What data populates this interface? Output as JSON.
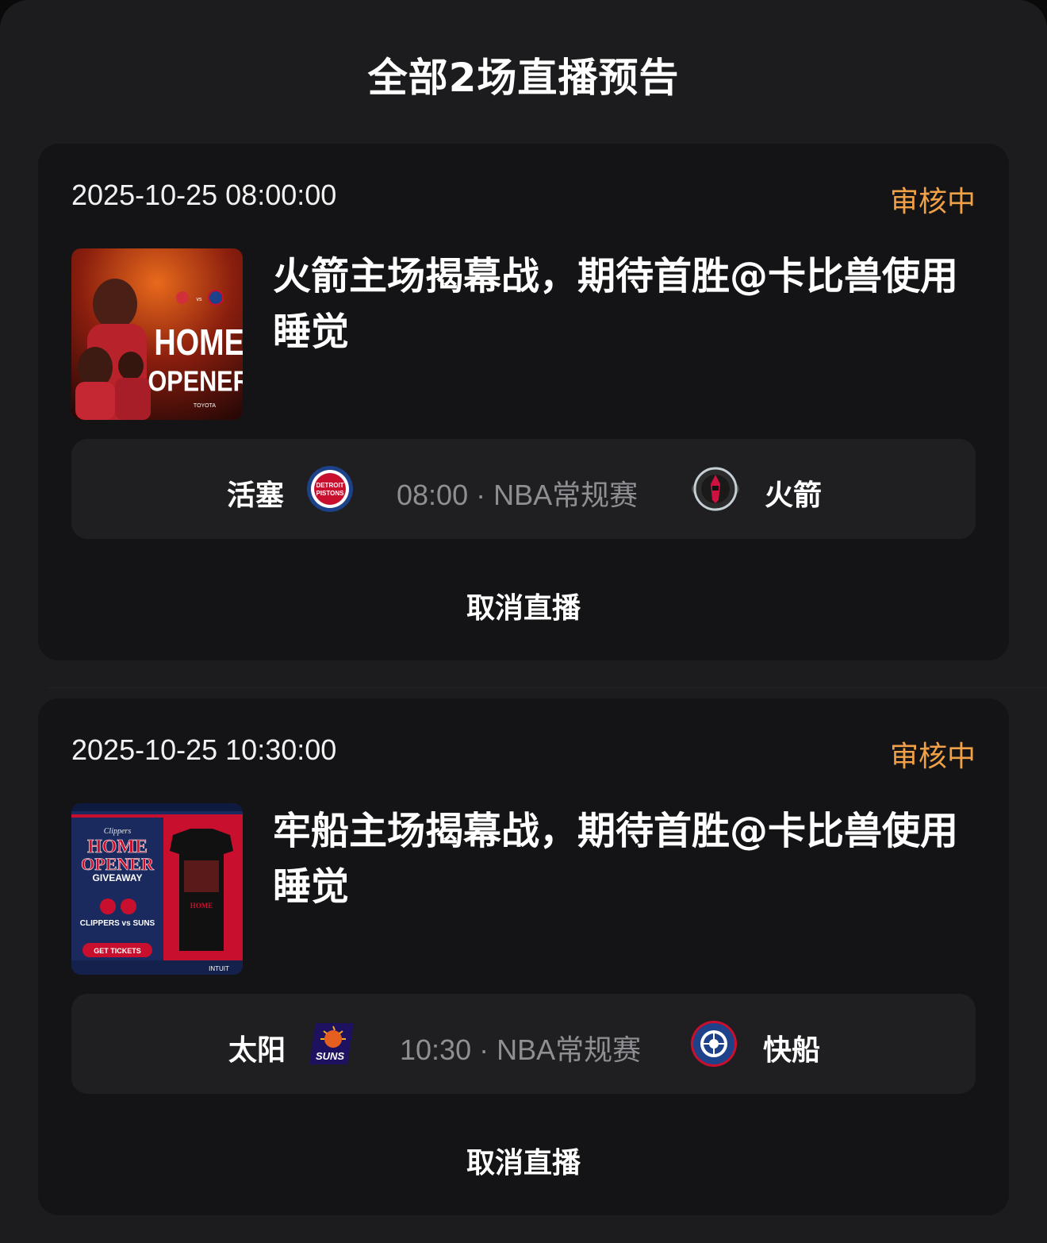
{
  "sheet": {
    "title": "全部2场直播预告"
  },
  "previews": [
    {
      "time": "2025-10-25 08:00:00",
      "status": "审核中",
      "title": "火箭主场揭幕战，期待首胜@卡比兽使用睡觉",
      "poster_text": {
        "line1": "HOME",
        "line2": "OPENER",
        "sponsor": "TOYOTA"
      },
      "away_team": "活塞",
      "home_team": "火箭",
      "match_info": "08:00 · NBA常规赛",
      "away_logo": "detroit-pistons-logo",
      "home_logo": "houston-rockets-logo",
      "cancel_label": "取消直播"
    },
    {
      "time": "2025-10-25 10:30:00",
      "status": "审核中",
      "title": "牢船主场揭幕战，期待首胜@卡比兽使用睡觉",
      "poster_text": {
        "script": "Clippers",
        "line1": "HOME",
        "line2": "OPENER",
        "line3": "GIVEAWAY",
        "matchup": "CLIPPERS vs SUNS",
        "button": "GET TICKETS",
        "sponsor": "INTUIT"
      },
      "away_team": "太阳",
      "home_team": "快船",
      "match_info": "10:30 · NBA常规赛",
      "away_logo": "phoenix-suns-logo",
      "home_logo": "la-clippers-logo",
      "cancel_label": "取消直播"
    }
  ],
  "colors": {
    "status": "#f0a046",
    "card_bg": "#141416",
    "sheet_bg": "#1c1c1e",
    "match_bg": "#1f1f22",
    "muted": "#8e8e93"
  }
}
